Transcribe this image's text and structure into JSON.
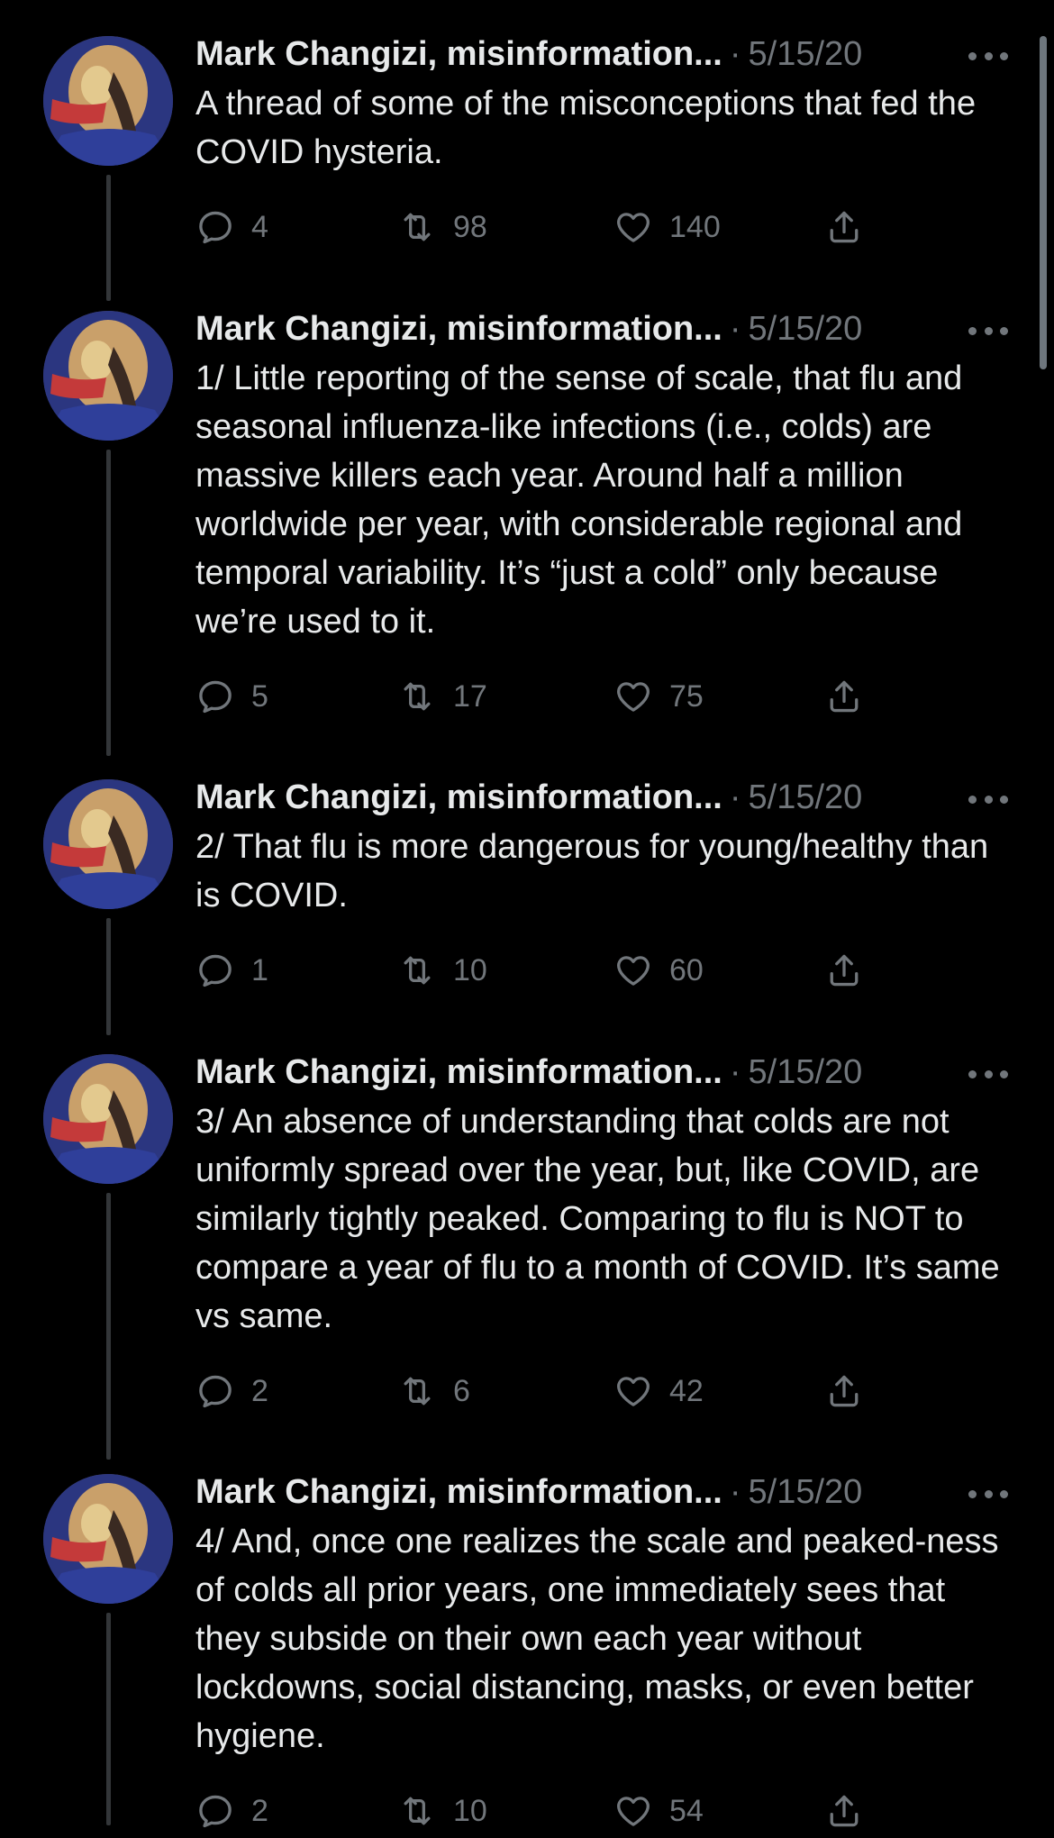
{
  "tweets": [
    {
      "author": "Mark Changizi, misinformation...",
      "date": "5/15/20",
      "text": "A thread of some of the misconceptions that fed the COVID hysteria.",
      "replies": "4",
      "retweets": "98",
      "likes": "140"
    },
    {
      "author": "Mark Changizi, misinformation...",
      "date": "5/15/20",
      "text": "1/ Little reporting of the sense of scale, that flu and seasonal influenza-like infections (i.e., colds) are massive killers each year. Around half a million worldwide per year, with considerable regional and temporal variability. It’s “just a cold” only because we’re used to it.",
      "replies": "5",
      "retweets": "17",
      "likes": "75"
    },
    {
      "author": "Mark Changizi, misinformation...",
      "date": "5/15/20",
      "text": "2/ That flu is more dangerous for young/healthy than is COVID.",
      "replies": "1",
      "retweets": "10",
      "likes": "60"
    },
    {
      "author": "Mark Changizi, misinformation...",
      "date": "5/15/20",
      "text": "3/ An absence of understanding that colds are not uniformly spread over the year, but, like COVID, are similarly tightly peaked. Comparing to flu is NOT to compare a year of flu to a month of COVID. It’s same vs same.",
      "replies": "2",
      "retweets": "6",
      "likes": "42"
    },
    {
      "author": "Mark Changizi, misinformation...",
      "date": "5/15/20",
      "text": "4/ And, once one realizes the scale and peaked-ness of colds all prior years, one immediately sees that they subside on their own each year without lockdowns, social distancing, masks, or even better hygiene.",
      "replies": "2",
      "retweets": "10",
      "likes": "54"
    }
  ],
  "ui": {
    "separator": "·"
  },
  "colors": {
    "background": "#000000",
    "text": "#e7e9ea",
    "secondary": "#71767b",
    "thread_line": "#333639"
  }
}
